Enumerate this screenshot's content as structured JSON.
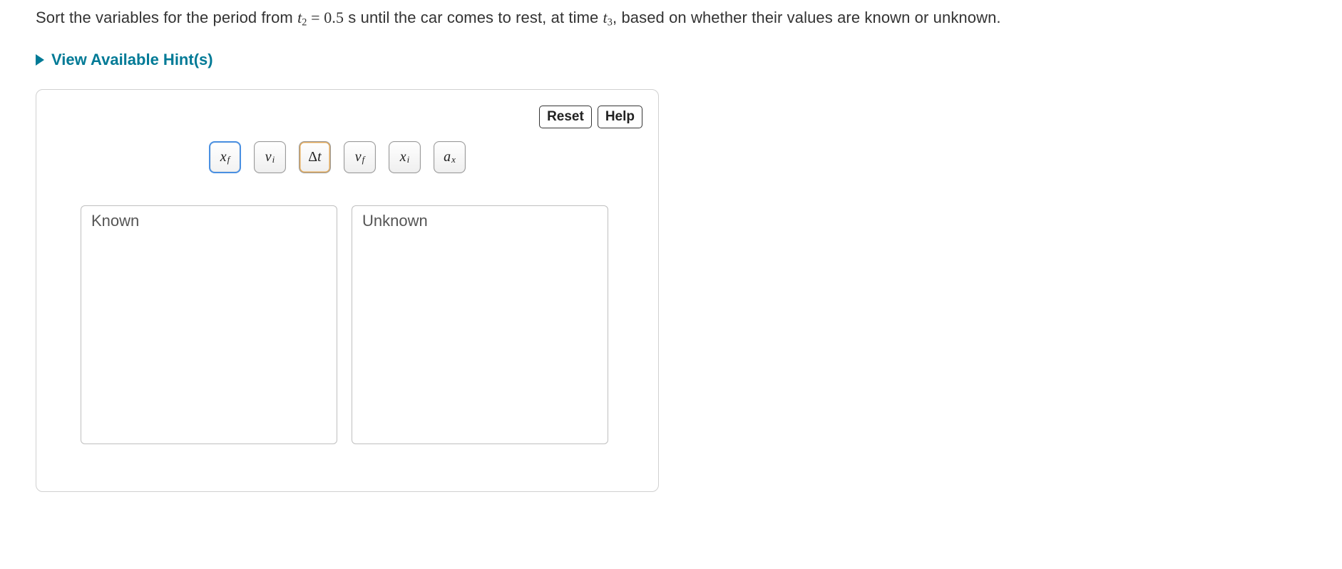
{
  "instruction": {
    "pre": "Sort the variables for the period from ",
    "t2_var": "t",
    "t2_sub": "2",
    "eq": " = ",
    "t2_val": "0.5",
    "mid1": " s until the car comes to rest, at time ",
    "t3_var": "t",
    "t3_sub": "3",
    "post": ", based on whether their values are known or unknown."
  },
  "hints_label": "View Available Hint(s)",
  "toolbar": {
    "reset": "Reset",
    "help": "Help"
  },
  "chips": {
    "xf_main": "x",
    "xf_sub": "f",
    "vi_main": "v",
    "vi_sub": "i",
    "dt_delta": "Δ",
    "dt_main": "t",
    "vf_main": "v",
    "vf_sub": "f",
    "xi_main": "x",
    "xi_sub": "i",
    "ax_main": "a",
    "ax_sub": "x"
  },
  "bins": {
    "known": "Known",
    "unknown": "Unknown"
  }
}
